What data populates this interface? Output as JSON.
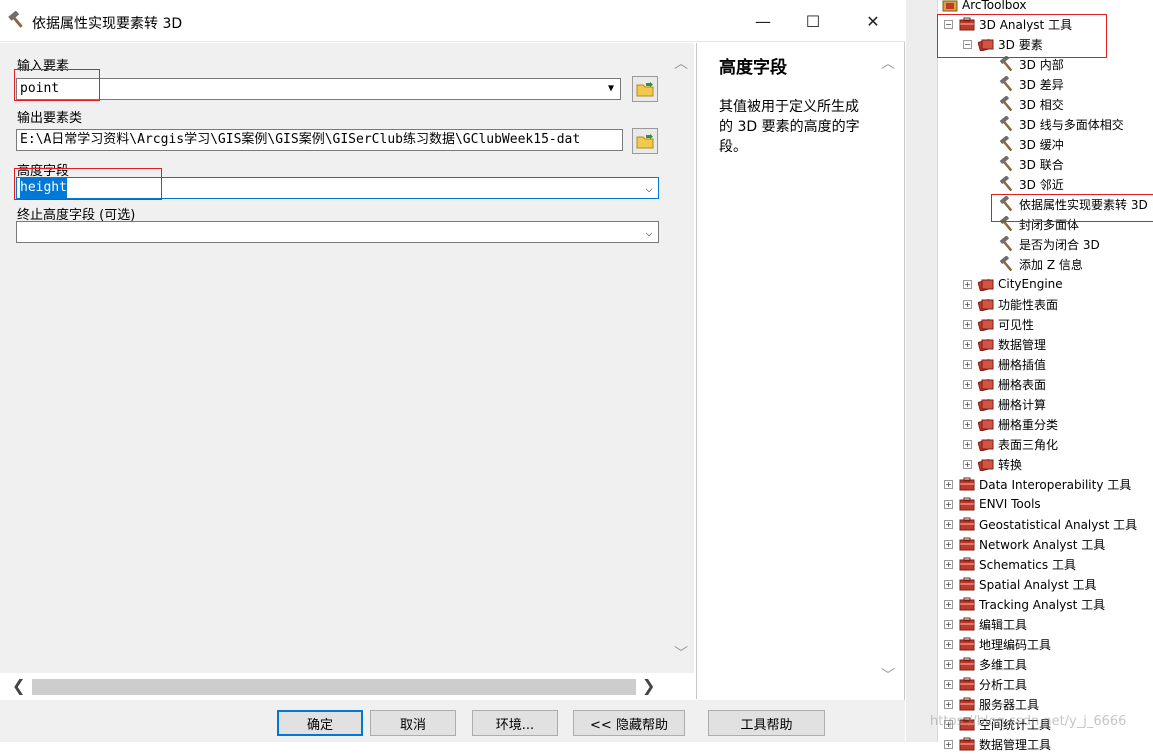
{
  "window": {
    "title": "依据属性实现要素转 3D",
    "minimize_glyph": "—",
    "maximize_glyph": "☐",
    "close_glyph": "✕"
  },
  "form": {
    "input_features": {
      "label": "输入要素",
      "value": "point"
    },
    "output_features": {
      "label": "输出要素类",
      "value": "E:\\A日常学习资料\\Arcgis学习\\GIS案例\\GIS案例\\GISerClub练习数据\\GClubWeek15-dat"
    },
    "height_field": {
      "label": "高度字段",
      "value": "height"
    },
    "to_height_field": {
      "label": "终止高度字段 (可选)",
      "value": ""
    }
  },
  "help": {
    "title": "高度字段",
    "body": "其值被用于定义所生成的 3D 要素的高度的字段。"
  },
  "buttons": {
    "ok": "确定",
    "cancel": "取消",
    "environments": "环境...",
    "hide_help": "<< 隐藏帮助",
    "tool_help": "工具帮助"
  },
  "toolbox": {
    "root": "ArcToolbox",
    "analyst_3d": "3D Analyst 工具",
    "features_3d": "3D 要素",
    "tools": [
      "3D 内部",
      "3D 差异",
      "3D 相交",
      "3D 线与多面体相交",
      "3D 缓冲",
      "3D 联合",
      "3D 邻近",
      "依据属性实现要素转 3D",
      "封闭多面体",
      "是否为闭合 3D",
      "添加 Z 信息"
    ],
    "subsets": [
      "CityEngine",
      "功能性表面",
      "可见性",
      "数据管理",
      "栅格插值",
      "栅格表面",
      "栅格计算",
      "栅格重分类",
      "表面三角化",
      "转换"
    ],
    "toolboxes": [
      "Data Interoperability 工具",
      "ENVI Tools",
      "Geostatistical Analyst 工具",
      "Network Analyst 工具",
      "Schematics 工具",
      "Spatial Analyst 工具",
      "Tracking Analyst 工具",
      "编辑工具",
      "地理编码工具",
      "多维工具",
      "分析工具",
      "服务器工具",
      "空间统计工具",
      "数据管理工具"
    ],
    "watermark": "https://blog.csdn.net/y_j_6666"
  },
  "colors": {
    "accent": "#0078d7",
    "highlight_box": "#e02020",
    "toolbox_red": "#c0392b"
  }
}
